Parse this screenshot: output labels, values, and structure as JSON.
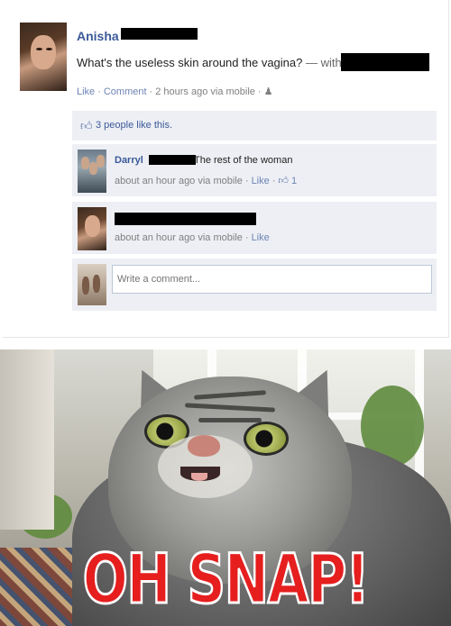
{
  "post": {
    "poster_name": "Anisha",
    "status": "What's the useless skin around the vagina?",
    "with_label": "— with",
    "meta": {
      "like": "Like",
      "comment": "Comment",
      "time": "2 hours ago via mobile"
    },
    "likes_text": "3 people like this.",
    "comments": [
      {
        "name": "Darryl",
        "text": "The rest of the woman",
        "time": "about an hour ago via mobile",
        "like": "Like",
        "like_count": "1"
      },
      {
        "name": "",
        "text": "",
        "time": "about an hour ago via mobile",
        "like": "Like"
      }
    ],
    "comment_placeholder": "Write a comment..."
  },
  "meme": {
    "caption": "OH SNAP!"
  },
  "colors": {
    "link": "#3b5998",
    "ufi_bg": "#edeff4",
    "caption": "#e61e1e"
  },
  "icons": [
    "thumbs-up-icon",
    "people-icon"
  ]
}
